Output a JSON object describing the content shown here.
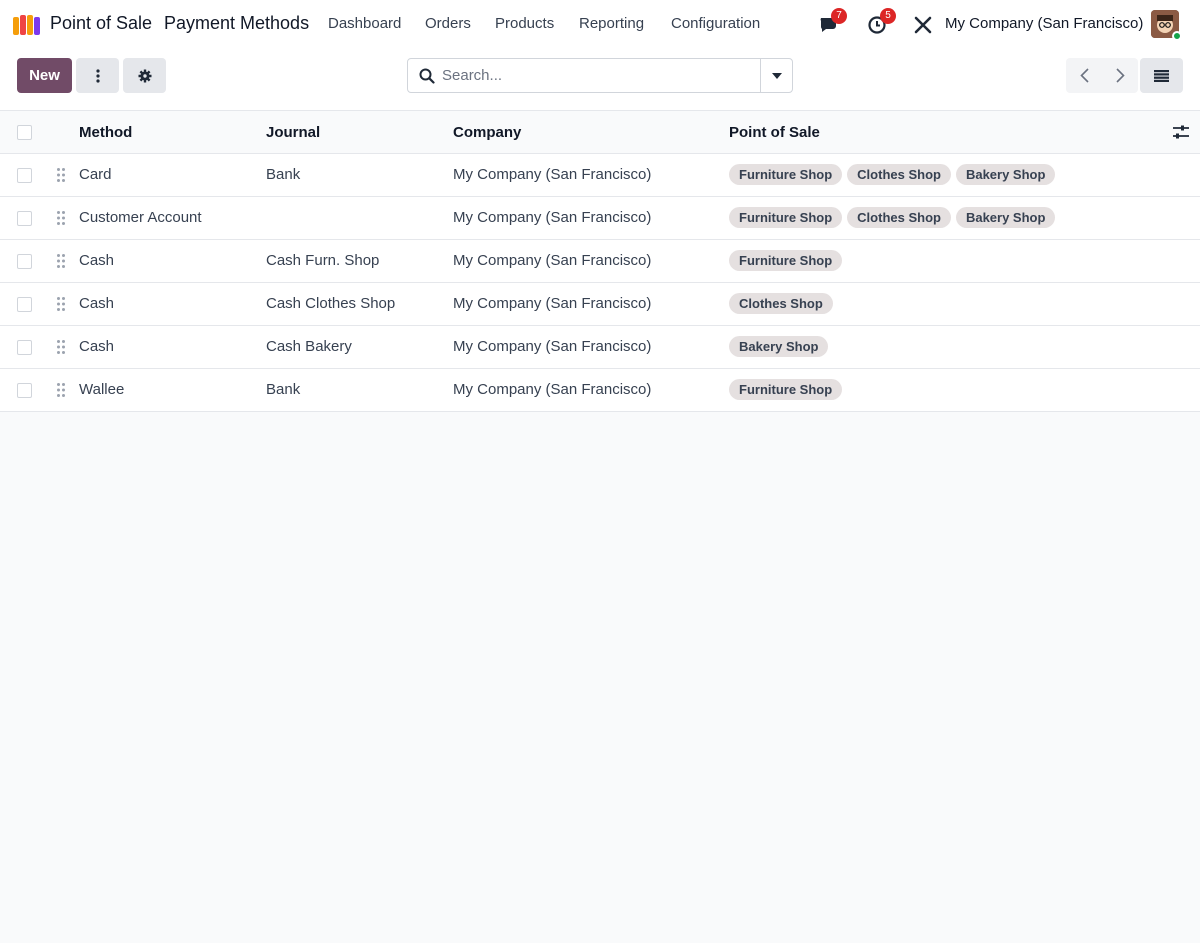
{
  "topbar": {
    "app_name": "Point of Sale",
    "page_title": "Payment Methods",
    "menu": [
      "Dashboard",
      "Orders",
      "Products",
      "Reporting",
      "Configuration"
    ],
    "messages_count": "7",
    "activities_count": "5",
    "company": "My Company (San Francisco)",
    "icons": {
      "app": "pos-app-icon",
      "messages": "chat-icon",
      "activities": "clock-icon",
      "debug": "tools-icon",
      "avatar": "user-avatar"
    }
  },
  "control": {
    "new_label": "New",
    "search_placeholder": "Search...",
    "search_value": ""
  },
  "table": {
    "columns": [
      "Method",
      "Journal",
      "Company",
      "Point of Sale"
    ],
    "rows": [
      {
        "method": "Card",
        "journal": "Bank",
        "company": "My Company (San Francisco)",
        "pos": [
          "Furniture Shop",
          "Clothes Shop",
          "Bakery Shop"
        ]
      },
      {
        "method": "Customer Account",
        "journal": "",
        "company": "My Company (San Francisco)",
        "pos": [
          "Furniture Shop",
          "Clothes Shop",
          "Bakery Shop"
        ]
      },
      {
        "method": "Cash",
        "journal": "Cash Furn. Shop",
        "company": "My Company (San Francisco)",
        "pos": [
          "Furniture Shop"
        ]
      },
      {
        "method": "Cash",
        "journal": "Cash Clothes Shop",
        "company": "My Company (San Francisco)",
        "pos": [
          "Clothes Shop"
        ]
      },
      {
        "method": "Cash",
        "journal": "Cash Bakery",
        "company": "My Company (San Francisco)",
        "pos": [
          "Bakery Shop"
        ]
      },
      {
        "method": "Wallee",
        "journal": "Bank",
        "company": "My Company (San Francisco)",
        "pos": [
          "Furniture Shop"
        ]
      }
    ]
  },
  "colors": {
    "primary": "#714b67",
    "badge": "#dc2626",
    "tag_bg": "#e5e0e0"
  }
}
